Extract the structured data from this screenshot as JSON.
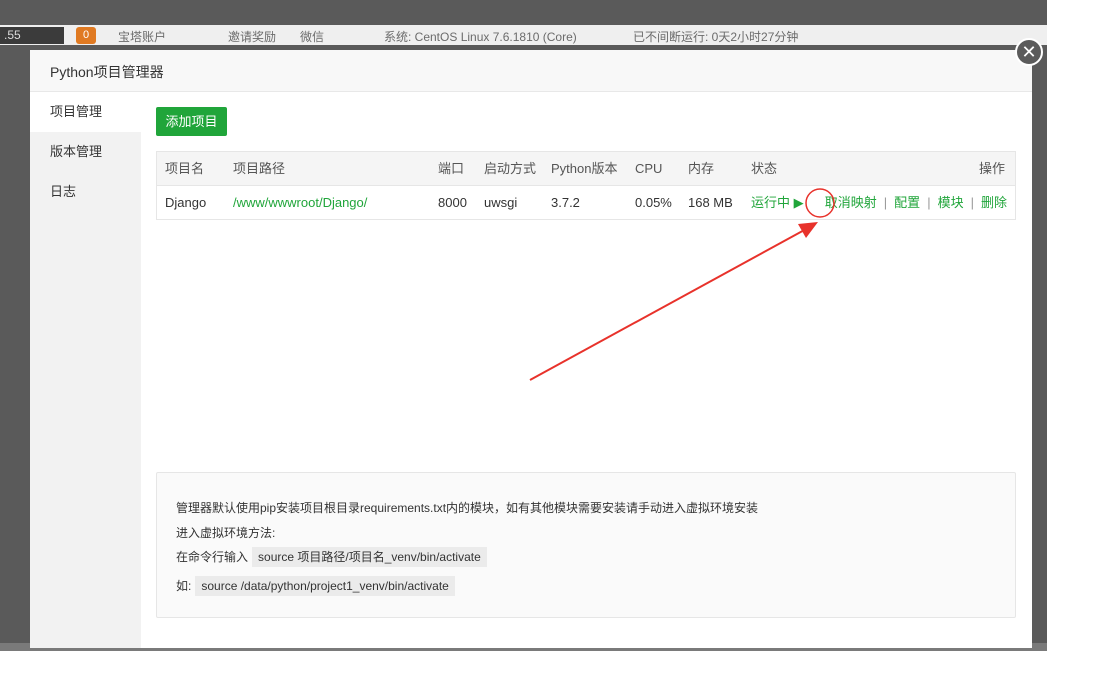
{
  "background": {
    "time": ".55",
    "badge": "0",
    "items": [
      "宝塔账户",
      "邀请奖励",
      "微信",
      "系统:  CentOS Linux 7.6.1810 (Core)",
      "已不间断运行: 0天2小时27分钟"
    ]
  },
  "modal": {
    "title": "Python项目管理器",
    "close_icon": "close-icon"
  },
  "sidebar": {
    "items": [
      {
        "label": "项目管理",
        "active": true
      },
      {
        "label": "版本管理",
        "active": false
      },
      {
        "label": "日志",
        "active": false
      }
    ]
  },
  "toolbar": {
    "add_label": "添加项目"
  },
  "table": {
    "headers": [
      "项目名",
      "项目路径",
      "端口",
      "启动方式",
      "Python版本",
      "CPU",
      "内存",
      "状态",
      "操作"
    ],
    "rows": [
      {
        "name": "Django",
        "path": "/www/wwwroot/Django/",
        "port": "8000",
        "start": "uwsgi",
        "python": "3.7.2",
        "cpu": "0.05%",
        "mem": "168 MB",
        "status": "运行中 ▶",
        "actions": [
          "取消映射",
          "配置",
          "模块",
          "删除"
        ]
      }
    ]
  },
  "hint": {
    "line1": "管理器默认使用pip安装项目根目录requirements.txt内的模块，如有其他模块需要安装请手动进入虚拟环境安装",
    "line2": "进入虚拟环境方法:",
    "line3_label": "在命令行输入",
    "line3_code": "source 项目路径/项目名_venv/bin/activate",
    "line4_label": "如:",
    "line4_code": "source /data/python/project1_venv/bin/activate"
  },
  "colors": {
    "accent": "#20a53a",
    "annotation": "#e8322b"
  }
}
